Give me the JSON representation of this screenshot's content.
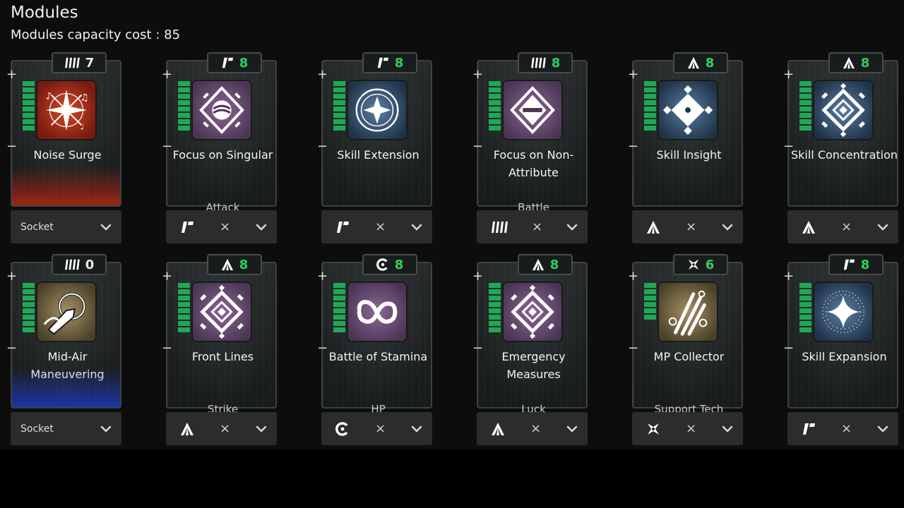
{
  "header": {
    "title": "Modules",
    "capacity": "Modules capacity cost : 85"
  },
  "controls": {
    "plus": "+",
    "minus": "−",
    "remove": "×"
  },
  "colors": {
    "bars": "#1fa956",
    "cost_value": "#2fd05b"
  },
  "modules": [
    {
      "name": "Noise Surge",
      "cost": "7",
      "type": "bars",
      "attribute": "",
      "socket": "Socket",
      "icon": "noise-surge",
      "bg": "red",
      "glow": "red",
      "cost_white": true,
      "bar_level": 8
    },
    {
      "name": "Focus on Singular",
      "cost": "8",
      "type": "slash",
      "attribute": "Attack",
      "socket": "",
      "icon": "diamond-orb",
      "bg": "purple",
      "glow": "",
      "cost_white": false,
      "bar_level": 8
    },
    {
      "name": "Skill Extension",
      "cost": "8",
      "type": "slash",
      "attribute": "",
      "socket": "",
      "icon": "compass-star",
      "bg": "blue",
      "glow": "",
      "cost_white": false,
      "bar_level": 8
    },
    {
      "name": "Focus on Non-Attribute",
      "cost": "8",
      "type": "bars",
      "attribute": "Battle",
      "socket": "",
      "icon": "diamond-bar",
      "bg": "purple",
      "glow": "",
      "cost_white": false,
      "bar_level": 8
    },
    {
      "name": "Skill Insight",
      "cost": "8",
      "type": "chevron",
      "attribute": "",
      "socket": "",
      "icon": "cross-diamond",
      "bg": "blue",
      "glow": "",
      "cost_white": false,
      "bar_level": 8
    },
    {
      "name": "Skill Concentration",
      "cost": "8",
      "type": "chevron",
      "attribute": "",
      "socket": "",
      "icon": "nested-diamond",
      "bg": "blue",
      "glow": "",
      "cost_white": false,
      "bar_level": 8
    },
    {
      "name": "Mid-Air Maneuvering",
      "cost": "0",
      "type": "bars",
      "attribute": "",
      "socket": "Socket",
      "icon": "mid-air",
      "bg": "gold",
      "glow": "blue",
      "cost_white": true,
      "bar_level": 8
    },
    {
      "name": "Front Lines",
      "cost": "8",
      "type": "chevron",
      "attribute": "Strike",
      "socket": "",
      "icon": "nested-diamond",
      "bg": "purple",
      "glow": "",
      "cost_white": false,
      "bar_level": 8
    },
    {
      "name": "Battle of Stamina",
      "cost": "8",
      "type": "c",
      "attribute": "HP",
      "socket": "",
      "icon": "infinity",
      "bg": "purple",
      "glow": "",
      "cost_white": false,
      "bar_level": 8
    },
    {
      "name": "Emergency Measures",
      "cost": "8",
      "type": "chevron",
      "attribute": "Luck",
      "socket": "",
      "icon": "nested-diamond",
      "bg": "purple",
      "glow": "",
      "cost_white": false,
      "bar_level": 8
    },
    {
      "name": "MP Collector",
      "cost": "6",
      "type": "star",
      "attribute": "Support Tech",
      "socket": "",
      "icon": "claw",
      "bg": "gold",
      "glow": "",
      "cost_white": false,
      "bar_level": 6
    },
    {
      "name": "Skill Expansion",
      "cost": "8",
      "type": "slash",
      "attribute": "",
      "socket": "",
      "icon": "sparkle",
      "bg": "blue",
      "glow": "",
      "cost_white": false,
      "bar_level": 8
    }
  ]
}
